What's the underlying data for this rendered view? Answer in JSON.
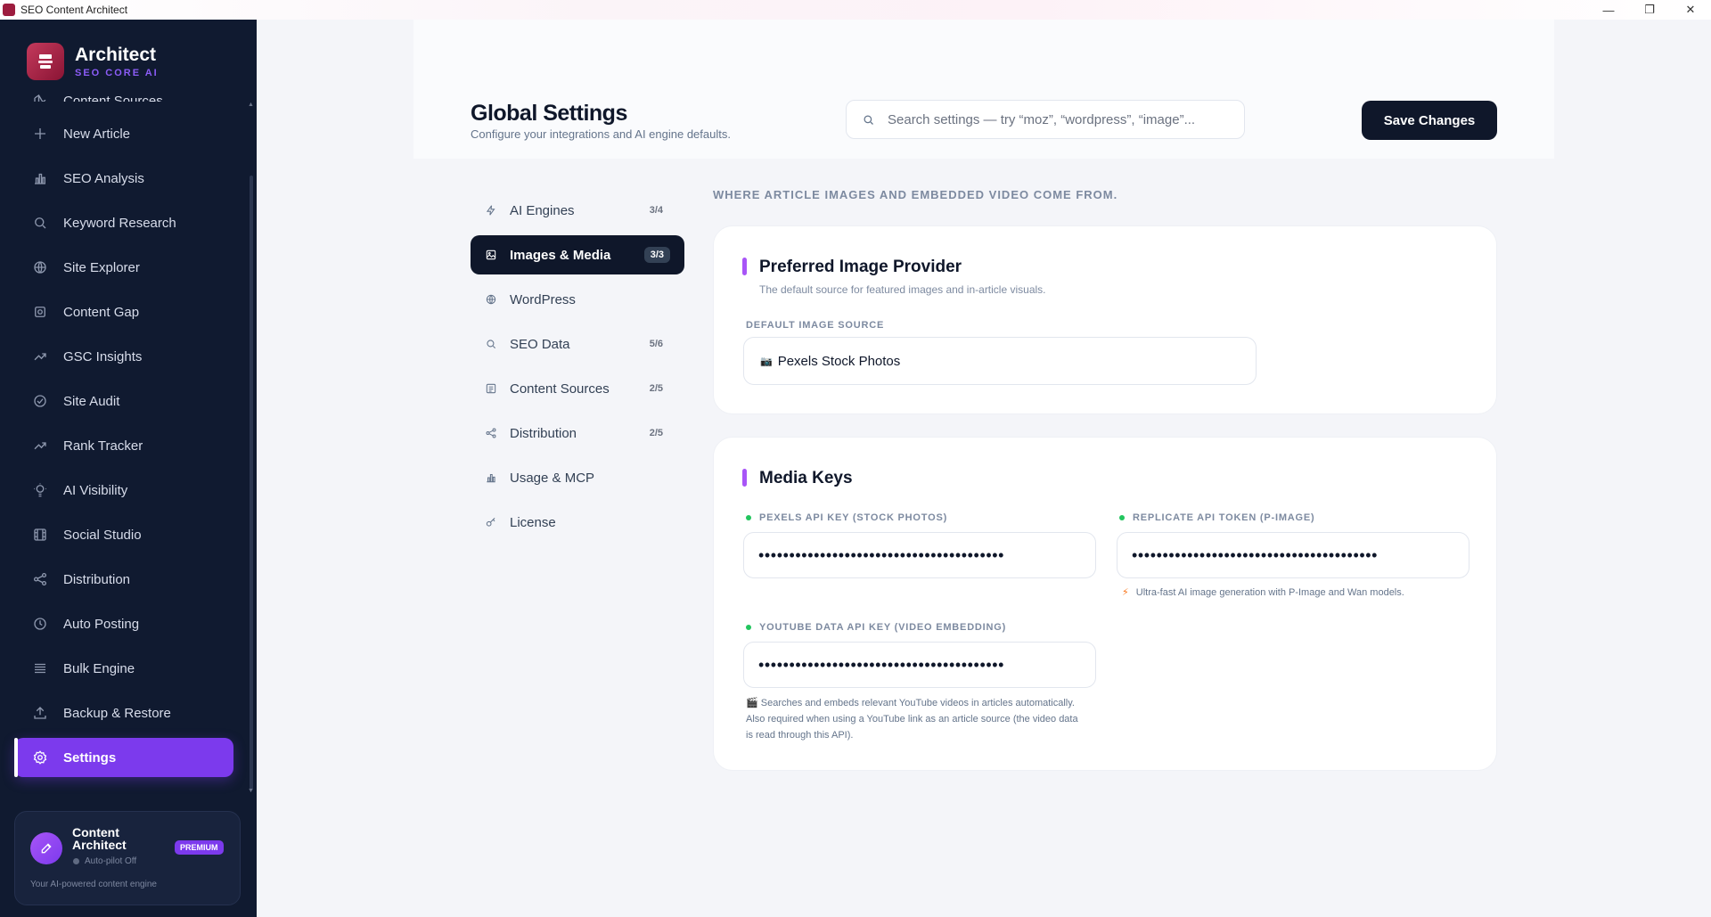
{
  "window": {
    "title": "SEO Content Architect",
    "controls": {
      "minimize": "—",
      "restore": "❐",
      "close": "✕"
    }
  },
  "brand": {
    "name": "Architect",
    "subtitle": "SEO CORE AI"
  },
  "sidebar": {
    "items": [
      {
        "label": "Content Sources",
        "icon": "content-sources-icon"
      },
      {
        "label": "New Article",
        "icon": "plus-icon"
      },
      {
        "label": "SEO Analysis",
        "icon": "bar-chart-icon"
      },
      {
        "label": "Keyword Research",
        "icon": "search-icon"
      },
      {
        "label": "Site Explorer",
        "icon": "globe-icon"
      },
      {
        "label": "Content Gap",
        "icon": "gear-icon"
      },
      {
        "label": "GSC Insights",
        "icon": "trend-up-icon"
      },
      {
        "label": "Site Audit",
        "icon": "check-circle-icon"
      },
      {
        "label": "Rank Tracker",
        "icon": "trend-up-icon"
      },
      {
        "label": "AI Visibility",
        "icon": "lightbulb-icon"
      },
      {
        "label": "Social Studio",
        "icon": "film-icon"
      },
      {
        "label": "Distribution",
        "icon": "share-icon"
      },
      {
        "label": "Auto Posting",
        "icon": "clock-icon"
      },
      {
        "label": "Bulk Engine",
        "icon": "list-icon"
      },
      {
        "label": "Backup & Restore",
        "icon": "upload-icon"
      },
      {
        "label": "Settings",
        "icon": "settings-icon",
        "active": true
      }
    ],
    "promo": {
      "title": "Content Architect",
      "badge": "PREMIUM",
      "status": "Auto-pilot Off",
      "footer": "Your AI-powered content engine"
    }
  },
  "header": {
    "title": "Global Settings",
    "subtitle": "Configure your integrations and AI engine defaults.",
    "search_placeholder": "Search settings — try “moz”, “wordpress”, “image”...",
    "save_label": "Save Changes"
  },
  "settings_nav": [
    {
      "label": "AI Engines",
      "count": "3/4",
      "icon": "bolt-icon"
    },
    {
      "label": "Images & Media",
      "count": "3/3",
      "icon": "image-icon",
      "active": true
    },
    {
      "label": "WordPress",
      "count": "",
      "icon": "globe-icon"
    },
    {
      "label": "SEO Data",
      "count": "5/6",
      "icon": "search-icon"
    },
    {
      "label": "Content Sources",
      "count": "2/5",
      "icon": "content-sources-icon"
    },
    {
      "label": "Distribution",
      "count": "2/5",
      "icon": "share-icon"
    },
    {
      "label": "Usage & MCP",
      "count": "",
      "icon": "bar-chart-icon"
    },
    {
      "label": "License",
      "count": "",
      "icon": "key-icon"
    }
  ],
  "content": {
    "section_note": "WHERE ARTICLE IMAGES AND EMBEDDED VIDEO COME FROM.",
    "provider_card": {
      "title": "Preferred Image Provider",
      "description": "The default source for featured images and in-article visuals.",
      "field_label": "DEFAULT IMAGE SOURCE",
      "selected": "Pexels Stock Photos",
      "selected_icon": "📷"
    },
    "keys_card": {
      "title": "Media Keys",
      "pexels_label": "PEXELS API KEY (STOCK PHOTOS)",
      "pexels_value": "••••••••••••••••••••••••••••••••••••••••",
      "replicate_label": "REPLICATE API TOKEN (P-IMAGE)",
      "replicate_value": "••••••••••••••••••••••••••••••••••••••••",
      "replicate_hint": "Ultra-fast AI image generation with P-Image and Wan models.",
      "replicate_hint_icon": "⚡",
      "youtube_label": "YOUTUBE DATA API KEY (VIDEO EMBEDDING)",
      "youtube_value": "••••••••••••••••••••••••••••••••••••••••",
      "youtube_hint_icon": "🎬",
      "youtube_hint_1": "Searches and embeds relevant YouTube videos in articles automatically.",
      "youtube_hint_2": "Also required when using a YouTube link as an article source (the video data",
      "youtube_hint_3": "is read through this API)."
    }
  },
  "colors": {
    "sidebar_bg": "#101a30",
    "accent": "#7c3aed",
    "primary_dark": "#0f172a",
    "status_dot": "#22c55e"
  }
}
